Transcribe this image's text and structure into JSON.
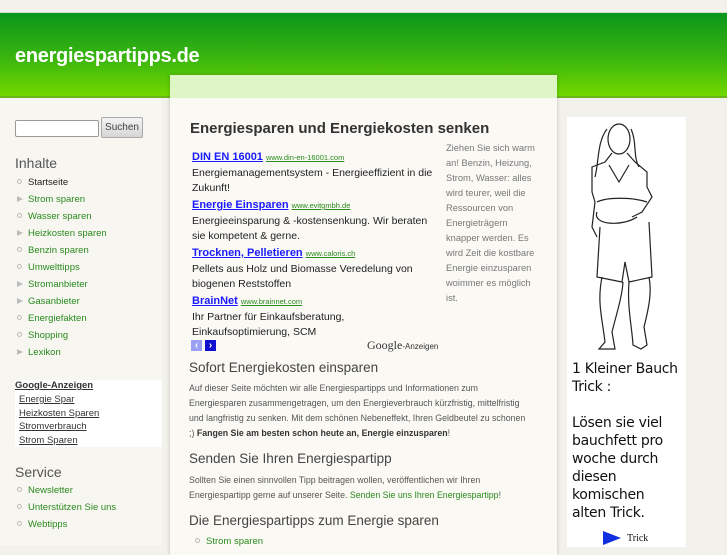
{
  "header": {
    "site_title": "energiespartipps.de"
  },
  "search": {
    "button": "Suchen",
    "value": ""
  },
  "sidebar": {
    "inhalte_title": "Inhalte",
    "inhalte": [
      {
        "label": "Startseite",
        "marker": "circle"
      },
      {
        "label": "Strom sparen",
        "marker": "triangle"
      },
      {
        "label": "Wasser sparen",
        "marker": "circle"
      },
      {
        "label": "Heizkosten sparen",
        "marker": "triangle"
      },
      {
        "label": "Benzin sparen",
        "marker": "circle"
      },
      {
        "label": "Umwelttipps",
        "marker": "circle"
      },
      {
        "label": "Stromanbieter",
        "marker": "triangle"
      },
      {
        "label": "Gasanbieter",
        "marker": "triangle"
      },
      {
        "label": "Energiefakten",
        "marker": "circle"
      },
      {
        "label": "Shopping",
        "marker": "circle"
      },
      {
        "label": "Lexikon",
        "marker": "triangle"
      }
    ],
    "google_ads_title": "Google-Anzeigen",
    "google_ads": [
      "Energie Spar",
      "Heizkosten Sparen",
      "Stromverbrauch",
      "Strom Sparen"
    ],
    "service_title": "Service",
    "service": [
      "Newsletter",
      "Unterstützen Sie uns",
      "Webtipps"
    ]
  },
  "main": {
    "title": "Energiesparen und Energiekosten senken",
    "ads": [
      {
        "title": "DIN EN 16001",
        "url": "www.din-en-16001.com",
        "desc": "Energiemanagementsystem - Energieeffizient in die Zukunft!"
      },
      {
        "title": "Energie Einsparen",
        "url": "www.evitgmbh.de",
        "desc": "Energieeinsparung & -kostensenkung. Wir beraten sie kompetent & gerne."
      },
      {
        "title": "Trocknen, Pelletieren",
        "url": "www.caloris.ch",
        "desc": "Pellets aus Holz und Biomasse Veredelung von biogenen Reststoffen"
      },
      {
        "title": "BrainNet",
        "url": "www.brainnet.com",
        "desc": "Ihr Partner für Einkaufsberatung, Einkaufsoptimierung, SCM"
      }
    ],
    "ads_label_brand": "Google",
    "ads_label": "-Anzeigen",
    "side_text": "Ziehen Sie sich warm an! Benzin, Heizung, Strom, Wasser: alles wird teurer, weil die Ressourcen von Energieträgern knapper werden. Es wird Zeit die kostbare Energie einzusparen woimmer es möglich ist.",
    "section1_title": "Sofort Energiekosten einsparen",
    "section1_text": "Auf dieser Seite möchten wir alle Energiespartipps und Informationen zum Energiesparen zusammengetragen, um den Energieverbrauch kürzfristig, mittelfristig und langfristig zu senken. Mit dem schönen Nebeneffekt, Ihren Geldbeutel zu schonen ;) ",
    "section1_bold": "Fangen Sie am besten schon heute an, Energie einzusparen",
    "section1_end": "!",
    "section2_title": "Senden Sie Ihren Energiespartipp",
    "section2_text": "Sollten Sie einen sinnvollen Tipp beitragen wollen, veröffentlichen wir Ihren Energiespartipp gerne auf unserer Seite. ",
    "section2_link": "Senden Sie uns Ihren Energiespartipp",
    "section2_end": "!",
    "section3_title": "Die Energiespartipps zum Energie sparen",
    "section3_items": [
      "Strom sparen"
    ]
  },
  "banner": {
    "line1": "1 Kleiner Bauch Trick :",
    "line2": "Lösen sie viel bauchfett pro woche durch diesen komischen alten Trick.",
    "cta": "Trick"
  },
  "colors": {
    "header_top": "#0a961c",
    "header_bottom": "#72d800",
    "link_green": "#2a8a1e",
    "ad_blue": "#1a1aff"
  }
}
